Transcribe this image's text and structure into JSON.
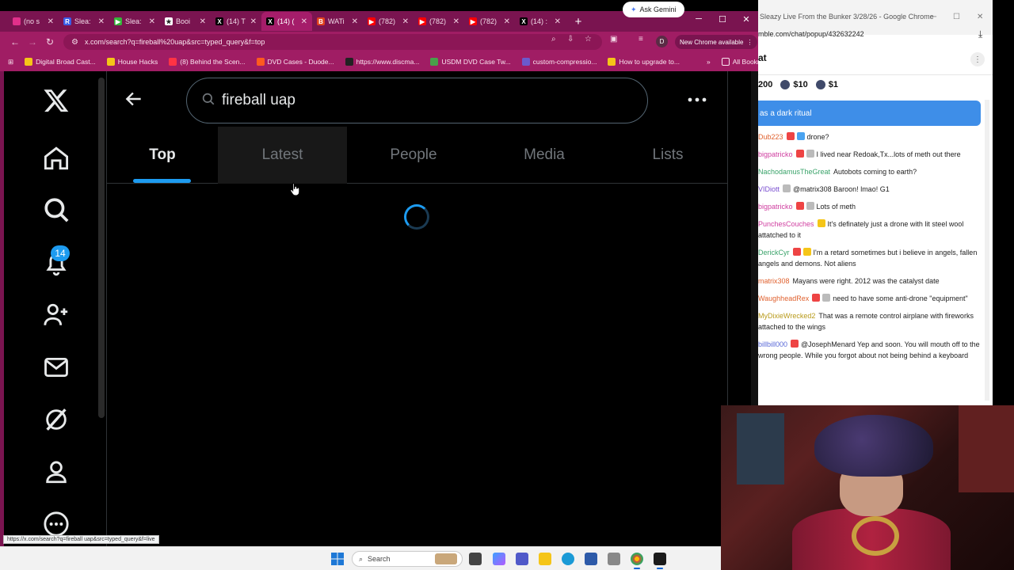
{
  "browser": {
    "tabs": [
      {
        "title": "(no s",
        "color": "#e0308a",
        "glyph": "",
        "active": false
      },
      {
        "title": "Slea:",
        "color": "#3b5ee8",
        "glyph": "R",
        "active": false
      },
      {
        "title": "Slea:",
        "color": "#35b53a",
        "glyph": "▶",
        "active": false
      },
      {
        "title": "Booi",
        "color": "#ffffff",
        "glyph": "★",
        "active": false
      },
      {
        "title": "(14) T",
        "color": "#000000",
        "glyph": "X",
        "active": false
      },
      {
        "title": "(14) (",
        "color": "#000000",
        "glyph": "X",
        "active": true
      },
      {
        "title": "WATi",
        "color": "#e0421f",
        "glyph": "B",
        "active": false
      },
      {
        "title": "(782)",
        "color": "#ff0000",
        "glyph": "▶",
        "active": false
      },
      {
        "title": "(782)",
        "color": "#ff0000",
        "glyph": "▶",
        "active": false
      },
      {
        "title": "(782)",
        "color": "#ff0000",
        "glyph": "▶",
        "active": false
      },
      {
        "title": "(14) :",
        "color": "#000000",
        "glyph": "X",
        "active": false
      }
    ],
    "gemini_label": "Ask Gemini",
    "url": "x.com/search?q=fireball%20uap&src=typed_query&f=top",
    "new_chrome": "New Chrome available",
    "profile_initial": "D",
    "bookmarks": [
      {
        "label": "Digital Broad Cast...",
        "color": "#f5c518"
      },
      {
        "label": "House Hacks",
        "color": "#f5c518"
      },
      {
        "label": "(8) Behind the Scen...",
        "color": "#ff3344"
      },
      {
        "label": "DVD Cases - Duode...",
        "color": "#ff5a1f"
      },
      {
        "label": "https://www.discma...",
        "color": "#222222"
      },
      {
        "label": "USDM DVD Case Tw...",
        "color": "#49a04a"
      },
      {
        "label": "custom-compressio...",
        "color": "#6a5acd"
      },
      {
        "label": "How to upgrade to...",
        "color": "#f5c518"
      }
    ],
    "all_bookmarks": "All Bookmarks",
    "status_url": "https://x.com/search?q=fireball uap&src=typed_query&f=live"
  },
  "x": {
    "notification_count": "14",
    "search_query": "fireball uap",
    "tabs": [
      "Top",
      "Latest",
      "People",
      "Media",
      "Lists"
    ],
    "active_tab": "Top",
    "accent": "#1d9bf0"
  },
  "chat": {
    "window_title": "Sleazy Live From the Bunker 3/28/26 - Google Chrome",
    "url": "mble.com/chat/popup/432632242",
    "header": "at",
    "rants": [
      "200",
      "$10",
      "$1"
    ],
    "pinned": "as a dark ritual",
    "messages": [
      {
        "user": "Dub223",
        "color": "#e0612e",
        "text": "drone?",
        "icons": [
          "red",
          "blue"
        ]
      },
      {
        "user": "bigpatricko",
        "color": "#d03fa0",
        "text": "I lived near Redoak,Tx...lots of meth out there",
        "icons": [
          "red",
          "gray"
        ]
      },
      {
        "user": "NachodamusTheGreat",
        "color": "#3aa36a",
        "text": "Autobots coming to earth?",
        "icons": []
      },
      {
        "user": "VIDiott",
        "color": "#7a4fd0",
        "text": "@matrix308 Baroon! lmao! G1",
        "icons": [
          "gray"
        ]
      },
      {
        "user": "bigpatricko",
        "color": "#d03fa0",
        "text": "Lots of meth",
        "icons": [
          "red",
          "gray"
        ]
      },
      {
        "user": "PunchesCouches",
        "color": "#d03fa0",
        "text": "It's definately just a drone with lit steel wool attatched to it",
        "icons": [
          "yel"
        ]
      },
      {
        "user": "DerickCyr",
        "color": "#3aa36a",
        "text": "I'm a retard sometimes but i believe in angels, fallen angels and demons. Not aliens",
        "icons": [
          "red",
          "yel"
        ]
      },
      {
        "user": "matrix308",
        "color": "#e0612e",
        "text": "Mayans were right. 2012 was the catalyst date",
        "icons": []
      },
      {
        "user": "WaughheadRex",
        "color": "#e0612e",
        "text": "need to have some anti-drone \"equipment\"",
        "icons": [
          "red",
          "gray"
        ]
      },
      {
        "user": "MyDixieWrecked2",
        "color": "#b89a1a",
        "text": "That was a remote control airplane with fireworks attached to the wings",
        "icons": []
      },
      {
        "user": "billbill000",
        "color": "#5a6ad8",
        "text": "@JosephMenard Yep and soon. You will mouth off to the wrong people. While you forgot about not being behind a keyboard",
        "icons": [
          "red"
        ]
      }
    ]
  },
  "taskbar": {
    "search_label": "Search"
  }
}
